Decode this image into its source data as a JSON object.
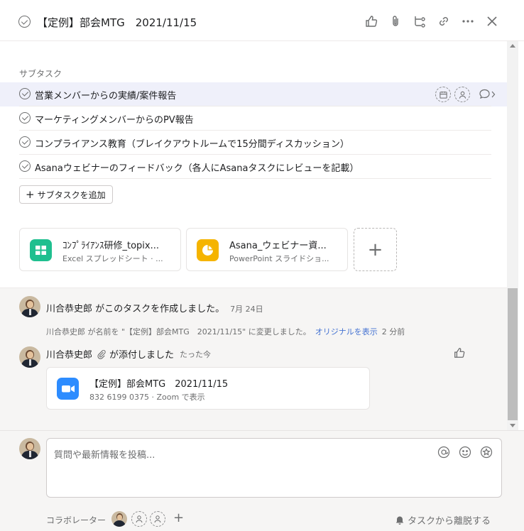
{
  "header": {
    "title": "【定例】部会MTG　2021/11/15",
    "icons": [
      "like-icon",
      "attachment-icon",
      "subtask-icon",
      "link-icon",
      "more-icon",
      "close-icon"
    ]
  },
  "subtasks": {
    "heading": "サブタスク",
    "items": [
      {
        "label": "営業メンバーからの実績/案件報告",
        "highlighted": true
      },
      {
        "label": "マーケティングメンバーからのPV報告",
        "highlighted": false
      },
      {
        "label": "コンプライアンス教育（ブレイクアウトルームで15分間ディスカッション）",
        "highlighted": false
      },
      {
        "label": "Asanaウェビナーのフィードバック（各人にAsanaタスクにレビューを記載）",
        "highlighted": false
      }
    ],
    "add_label": "サブタスクを追加"
  },
  "attachments": [
    {
      "name": "ｺﾝﾌﾟﾗｲｱﾝｽ研修_topix...",
      "sub": "Excel スプレッドシート · ...",
      "icon": "spreadsheet-icon",
      "color": "#1fbf8f"
    },
    {
      "name": "Asana_ウェビナー資...",
      "sub": "PowerPoint スライドショ...",
      "icon": "presentation-icon",
      "color": "#f5b400"
    }
  ],
  "activity": {
    "created": {
      "text": "川合恭史郎 がこのタスクを作成しました。",
      "time": "7月 24日"
    },
    "renamed": {
      "text": "川合恭史郎 が名前を \"【定例】部会MTG　2021/11/15\" に変更しました。",
      "link": "オリジナルを表示",
      "time": "2 分前"
    },
    "attached": {
      "user": "川合恭史郎",
      "text": "が添付しました",
      "time": "たった今"
    },
    "zoom": {
      "title": "【定例】部会MTG　2021/11/15",
      "sub": "832 6199 0375 · Zoom で表示",
      "color": "#2d8cff"
    }
  },
  "composer": {
    "placeholder": "質問や最新情報を投稿...",
    "collaborators_label": "コラボレーター",
    "leave_label": "タスクから離脱する"
  }
}
